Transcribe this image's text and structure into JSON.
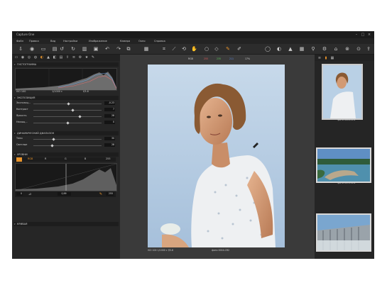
{
  "window": {
    "title": "Capture One",
    "controls": [
      "–",
      "□",
      "×"
    ]
  },
  "menu": [
    "Файл",
    "Правка",
    "Вид",
    "Настройки",
    "Изображение",
    "Камера",
    "Окно",
    "Справка"
  ],
  "left_panel": {
    "histogram": {
      "title": "ГИСТОГРАММА",
      "info_left": "ISO 100",
      "info_mid": "1/1000 с",
      "info_right": "f/5.6"
    },
    "exposure": {
      "title": "ЭКСПОЗИЦИЯ",
      "rows": [
        {
          "label": "Экспозиц...",
          "value": "-0.23",
          "level": 0.52
        },
        {
          "label": "Контраст",
          "value": "7",
          "level": 0.58
        },
        {
          "label": "Яркость",
          "value": "28",
          "level": 0.68
        },
        {
          "label": "Насыщ...",
          "value": "0",
          "level": 0.5
        }
      ]
    },
    "dynamic_range": {
      "title": "ДИНАМИЧЕСКИЙ ДИАПАЗОН",
      "rows": [
        {
          "label": "Тени",
          "value": "30",
          "level": 0.3
        },
        {
          "label": "Светлые",
          "value": "28",
          "level": 0.28
        }
      ]
    },
    "levels": {
      "title": "УРОВНИ",
      "channels": [
        "RGB",
        "R",
        "G",
        "B"
      ],
      "left_value": "0",
      "mid_value": "0,99",
      "right_value": "255"
    },
    "curve": {
      "title": "КРИВАЯ"
    }
  },
  "viewer": {
    "chips": [
      "RGB",
      "255",
      "235",
      "211",
      "17%"
    ],
    "caption_left": "ISO 100  1/1000 с  f/5.6",
    "caption_right": "фото 0004.CR2"
  },
  "browser": {
    "thumbs": [
      {
        "caption": "фото 0004.CR2",
        "kind": "portrait"
      },
      {
        "caption": "фото 0172.CR2",
        "kind": "landscape"
      },
      {
        "caption": "",
        "kind": "dam"
      }
    ]
  },
  "colors": {
    "accent": "#e8932a",
    "panel": "#262626",
    "sky": "#b8cfe4"
  },
  "icons": {
    "toolbar": [
      "import-icon",
      "capture-icon",
      "browser-icon",
      "folder-icon",
      "rotate-left-icon",
      "rotate-right-icon",
      "delete-icon",
      "save-icon",
      "copy-icon",
      "undo-icon",
      "redo-icon",
      "grid-icon",
      "crop-icon",
      "straighten-icon",
      "rotate-icon",
      "hand-icon",
      "loupe-icon",
      "picker-icon",
      "magnify-icon",
      "brush-icon",
      "zoom-icon",
      "compare-icon",
      "alert-icon",
      "settings-icon"
    ]
  }
}
